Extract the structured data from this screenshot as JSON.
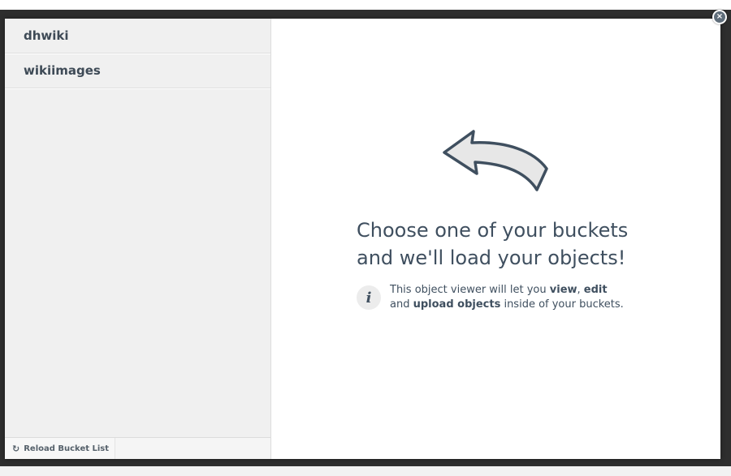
{
  "sidebar": {
    "buckets": [
      {
        "label": "dhwiki"
      },
      {
        "label": "wikiimages"
      }
    ],
    "reload_label": "Reload Bucket List",
    "reload_icon": "refresh-icon"
  },
  "main": {
    "headline_line1": "Choose one of your buckets",
    "headline_line2": "and we'll load your objects!",
    "info_icon_glyph": "i",
    "info": {
      "part1": "This object viewer will let you ",
      "view": "view",
      "comma": ", ",
      "edit": "edit",
      "part2": "and ",
      "upload": "upload objects",
      "part3": " inside of your buckets."
    }
  },
  "close_glyph": "×",
  "colors": {
    "text": "#3f4f5f",
    "sidebar_bg": "#f0f0f0",
    "backdrop": "#2e2e2e"
  }
}
